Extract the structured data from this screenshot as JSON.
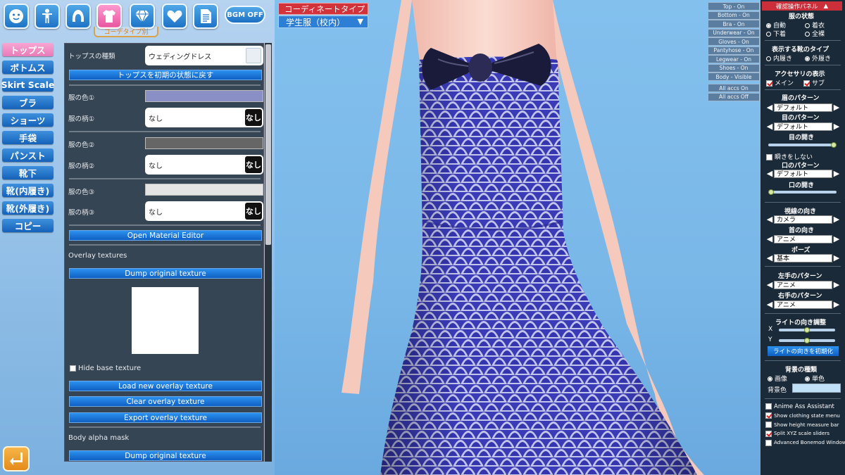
{
  "top_icons": [
    "face-icon",
    "body-icon",
    "hair-icon",
    "clothes-icon",
    "accessory-icon",
    "heart-icon",
    "document-icon"
  ],
  "bgm_label": "BGM OFF",
  "coordinate_tab_label": "コーデタイプ別",
  "categories": [
    "トップス",
    "ボトムス",
    "Skirt Scale",
    "ブラ",
    "ショーツ",
    "手袋",
    "パンスト",
    "靴下",
    "靴(内履き)",
    "靴(外履き)",
    "コピー"
  ],
  "selected_category": 0,
  "panel": {
    "tops_type_label": "トップスの種類",
    "tops_type_value": "ウェディングドレス",
    "reset_button": "トップスを初期の状態に戻す",
    "color1_label": "服の色①",
    "color1": "#8a8fc6",
    "pattern1_label": "服の柄①",
    "pattern1_value": "なし",
    "color2_label": "服の色②",
    "color2": "#666666",
    "pattern2_label": "服の柄②",
    "pattern2_value": "なし",
    "color3_label": "服の色③",
    "color3": "#e4e4e4",
    "pattern3_label": "服の柄③",
    "pattern3_value": "なし",
    "nashi_badge": "なし",
    "open_material_editor": "Open Material Editor",
    "overlay_textures_label": "Overlay textures",
    "dump_original_texture": "Dump original texture",
    "hide_base_texture": "Hide base texture",
    "load_overlay": "Load new overlay texture",
    "clear_overlay": "Clear overlay texture",
    "export_overlay": "Export overlay texture",
    "body_alpha_mask_label": "Body alpha mask",
    "dump_original_texture_2": "Dump original texture"
  },
  "coordinate": {
    "label": "コーディネートタイプ",
    "value": "学生服（校内）"
  },
  "state_buttons": [
    "Top - On",
    "Bottom - On",
    "Bra - On",
    "Underwear - On",
    "Gloves - On",
    "Pantyhose - On",
    "Legwear - On",
    "Shoes - On",
    "Body - Visible"
  ],
  "accs_buttons": [
    "All accs On",
    "All accs Off"
  ],
  "right_panel": {
    "header": "確認操作パネル",
    "collapse_glyph": "▲",
    "clothes_state_title": "服の状態",
    "clothes_state_options": [
      "自動",
      "着衣",
      "下着",
      "全裸"
    ],
    "shoes_title": "表示する靴のタイプ",
    "shoes_options": [
      "内履き",
      "外履き"
    ],
    "accessory_title": "アクセサリの表示",
    "accessory_options": [
      "メイン",
      "サブ"
    ],
    "eyebrow_title": "眉のパターン",
    "eyebrow_value": "デフォルト",
    "eye_title": "目のパターン",
    "eye_value": "デフォルト",
    "eye_open_title": "目の開き",
    "eye_open_value": 1.0,
    "no_blink": "瞬きをしない",
    "mouth_title": "口のパターン",
    "mouth_value": "デフォルト",
    "mouth_open_title": "口の開き",
    "mouth_open_value": 0.0,
    "gaze_title": "視線の向き",
    "gaze_value": "カメラ",
    "neck_title": "首の向き",
    "neck_value": "アニメ",
    "pose_title": "ポーズ",
    "pose_value": "基本",
    "lhand_title": "左手のパターン",
    "lhand_value": "アニメ",
    "rhand_title": "右手のパターン",
    "rhand_value": "アニメ",
    "light_title": "ライトの向き調整",
    "light_x_label": "X",
    "light_x_value": 0.5,
    "light_y_label": "Y",
    "light_y_value": 0.5,
    "light_reset": "ライトの向きを初期化",
    "bg_type_title": "背景の種類",
    "bg_options": [
      "画像",
      "単色"
    ],
    "bg_color_label": "背景色",
    "bg_color": "#bfe0f7",
    "plugins": [
      {
        "label": "Anime Ass Assistant",
        "checked": false
      },
      {
        "label": "Show clothing state menu",
        "checked": true
      },
      {
        "label": "Show height measure bar",
        "checked": false
      },
      {
        "label": "Split XYZ scale sliders",
        "checked": true
      },
      {
        "label": "Advanced Bonemod Window",
        "checked": false
      }
    ]
  }
}
